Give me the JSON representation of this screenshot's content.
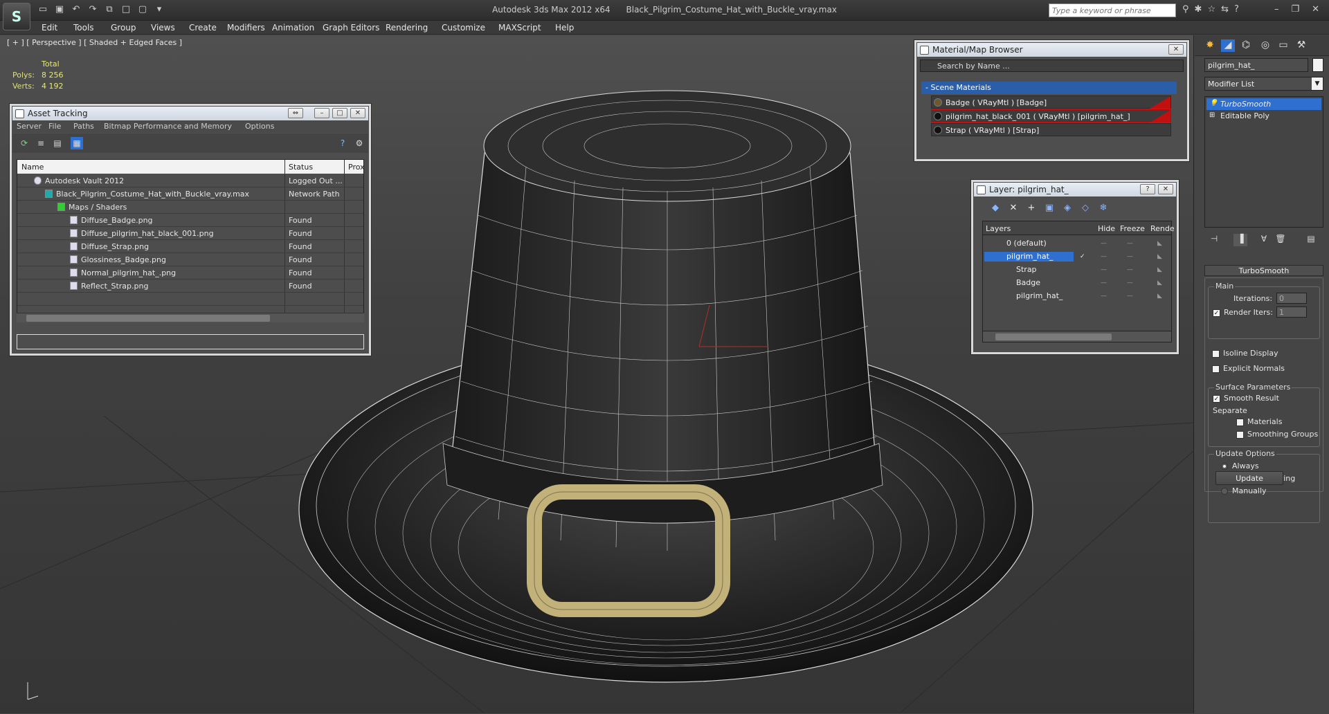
{
  "titlebar": {
    "app_title": "Autodesk 3ds Max  2012 x64",
    "file_title": "Black_Pilgrim_Costume_Hat_with_Buckle_vray.max",
    "search_placeholder": "Type a keyword or phrase"
  },
  "menu": [
    "Edit",
    "Tools",
    "Group",
    "Views",
    "Create",
    "Modifiers",
    "Animation",
    "Graph Editors",
    "Rendering",
    "Customize",
    "MAXScript",
    "Help"
  ],
  "viewport": {
    "label": "[ + ] [ Perspective ] [ Shaded + Edged Faces ]",
    "stats": {
      "total_label": "Total",
      "polys_label": "Polys:",
      "polys": "8 256",
      "verts_label": "Verts:",
      "verts": "4 192"
    }
  },
  "asset_tracking": {
    "title": "Asset Tracking",
    "menu": [
      "Server",
      "File",
      "Paths",
      "Bitmap Performance and Memory",
      "Options"
    ],
    "columns": [
      "Name",
      "Status",
      "Prox"
    ],
    "rows": [
      {
        "name": "Autodesk Vault 2012",
        "status": "Logged Out ..."
      },
      {
        "name": "Black_Pilgrim_Costume_Hat_with_Buckle_vray.max",
        "status": "Network Path"
      },
      {
        "name": "Maps / Shaders",
        "status": ""
      },
      {
        "name": "Diffuse_Badge.png",
        "status": "Found"
      },
      {
        "name": "Diffuse_pilgrim_hat_black_001.png",
        "status": "Found"
      },
      {
        "name": "Diffuse_Strap.png",
        "status": "Found"
      },
      {
        "name": "Glossiness_Badge.png",
        "status": "Found"
      },
      {
        "name": "Normal_pilgrim_hat_.png",
        "status": "Found"
      },
      {
        "name": "Reflect_Strap.png",
        "status": "Found"
      }
    ]
  },
  "material_browser": {
    "title": "Material/Map Browser",
    "search": "Search by Name ...",
    "section": "- Scene Materials",
    "materials": [
      "Badge  ( VRayMtl )  [Badge]",
      "pilgrim_hat_black_001  ( VRayMtl )  [pilgrim_hat_]",
      "Strap  ( VRayMtl )  [Strap]"
    ]
  },
  "layer_dialog": {
    "title": "Layer: pilgrim_hat_",
    "columns": [
      "Layers",
      "Hide",
      "Freeze",
      "Rende"
    ],
    "rows": [
      "0 (default)",
      "pilgrim_hat_",
      "Strap",
      "Badge",
      "pilgrim_hat_"
    ]
  },
  "command_panel": {
    "object_name": "pilgrim_hat_",
    "modifier_list": "Modifier List",
    "stack": [
      "TurboSmooth",
      "Editable Poly"
    ],
    "rollout_title": "TurboSmooth",
    "main_label": "Main",
    "iterations_label": "Iterations:",
    "iterations": "0",
    "render_iters_label": "Render Iters:",
    "render_iters": "1",
    "isoline": "Isoline Display",
    "explicit_normals": "Explicit Normals",
    "surface_params": "Surface Parameters",
    "smooth_result": "Smooth Result",
    "separate": "Separate",
    "materials": "Materials",
    "smoothing_groups": "Smoothing Groups",
    "update_options": "Update Options",
    "always": "Always",
    "when_rendering": "When Rendering",
    "manually": "Manually",
    "update_button": "Update"
  }
}
